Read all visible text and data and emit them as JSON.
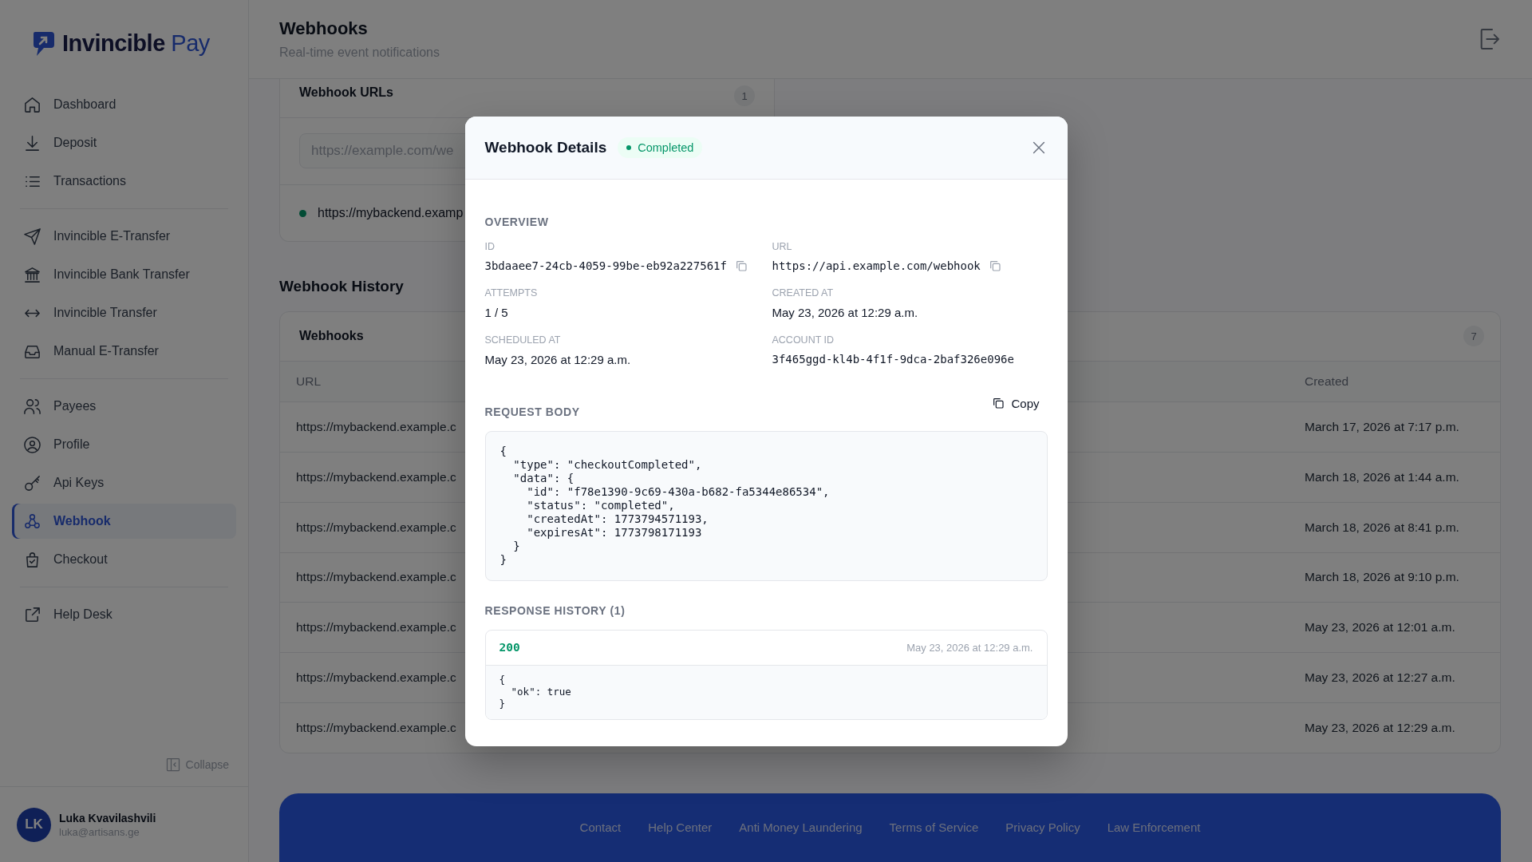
{
  "sidebar": {
    "logo": {
      "name": "Invincible",
      "accent": "Pay"
    },
    "groups": [
      {
        "items": [
          {
            "label": "Dashboard",
            "selected": false
          },
          {
            "label": "Deposit",
            "selected": false
          },
          {
            "label": "Transactions",
            "selected": false
          }
        ]
      },
      {
        "items": [
          {
            "label": "Invincible E-Transfer",
            "selected": false
          },
          {
            "label": "Invincible Bank Transfer",
            "selected": false
          },
          {
            "label": "Invincible Transfer",
            "selected": false
          },
          {
            "label": "Manual E-Transfer",
            "selected": false
          }
        ]
      },
      {
        "items": [
          {
            "label": "Payees",
            "selected": false
          },
          {
            "label": "Profile",
            "selected": false
          },
          {
            "label": "Api Keys",
            "selected": false
          },
          {
            "label": "Webhook",
            "selected": true
          },
          {
            "label": "Checkout",
            "selected": false
          }
        ]
      },
      {
        "items": [
          {
            "label": "Help Desk",
            "selected": false
          }
        ]
      }
    ],
    "collapse": "Collapse",
    "user": {
      "initials": "LK",
      "name": "Luka Kvavilashvili",
      "email": "luka@artisans.ge"
    }
  },
  "header": {
    "title": "Webhooks",
    "subtitle": "Real-time event notifications"
  },
  "webhook_urls": {
    "title": "Webhook URLs",
    "count": "1",
    "input": {
      "placeholder": "https://example.com/we"
    },
    "urls": [
      {
        "url": "https://mybackend.examp",
        "active": true
      }
    ]
  },
  "history": {
    "title": "Webhook History",
    "table": {
      "title": "Webhooks",
      "count": "7",
      "columns": [
        "URL",
        "Created"
      ],
      "rows": [
        {
          "url": "https://mybackend.example.c",
          "created": "March 17, 2026 at 7:17 p.m."
        },
        {
          "url": "https://mybackend.example.c",
          "created": "March 18, 2026 at 1:44 a.m."
        },
        {
          "url": "https://mybackend.example.c",
          "created": "March 18, 2026 at 8:41 p.m."
        },
        {
          "url": "https://mybackend.example.c",
          "created": "March 18, 2026 at 9:10 p.m."
        },
        {
          "url": "https://mybackend.example.c",
          "created": "May 23, 2026 at 12:01 a.m."
        },
        {
          "url": "https://mybackend.example.c",
          "created": "May 23, 2026 at 12:27 a.m."
        },
        {
          "url": "https://mybackend.example.c",
          "created": "May 23, 2026 at 12:29 a.m."
        }
      ]
    }
  },
  "modal": {
    "title": "Webhook Details",
    "status": {
      "label": "Completed",
      "kind": "success"
    },
    "overview": {
      "title": "OVERVIEW",
      "fields": [
        {
          "label": "ID",
          "value": "3bdaaee7-24cb-4059-99be-eb92a227561f",
          "kind": "code",
          "copyable": true
        },
        {
          "label": "URL",
          "value": "https://api.example.com/webhook",
          "kind": "code",
          "copyable": true
        },
        {
          "label": "ATTEMPTS",
          "value": "1 / 5",
          "kind": "text",
          "copyable": false
        },
        {
          "label": "CREATED AT",
          "value": "May 23, 2026 at 12:29 a.m.",
          "kind": "text",
          "copyable": false
        },
        {
          "label": "SCHEDULED AT",
          "value": "May 23, 2026 at 12:29 a.m.",
          "kind": "text",
          "copyable": false
        },
        {
          "label": "ACCOUNT ID",
          "value": "3f465ggd-kl4b-4f1f-9dca-2baf326e096e",
          "kind": "code",
          "copyable": false
        }
      ]
    },
    "request_body": {
      "title": "REQUEST BODY",
      "copy": "Copy",
      "code": "{\n  \"type\": \"checkoutCompleted\",\n  \"data\": {\n    \"id\": \"f78e1390-9c69-430a-b682-fa5344e86534\",\n    \"status\": \"completed\",\n    \"createdAt\": 1773794571193,\n    \"expiresAt\": 1773798171193\n  }\n}"
    },
    "response_history": {
      "title": "RESPONSE HISTORY (1)",
      "responses": [
        {
          "status": "200",
          "kind": "success",
          "time": "May 23, 2026 at 12:29 a.m.",
          "body": "{\n  \"ok\": true\n}"
        }
      ]
    }
  },
  "footer": {
    "links": [
      "Contact",
      "Help Center",
      "Anti Money Laundering",
      "Terms of Service",
      "Privacy Policy",
      "Law Enforcement"
    ]
  }
}
